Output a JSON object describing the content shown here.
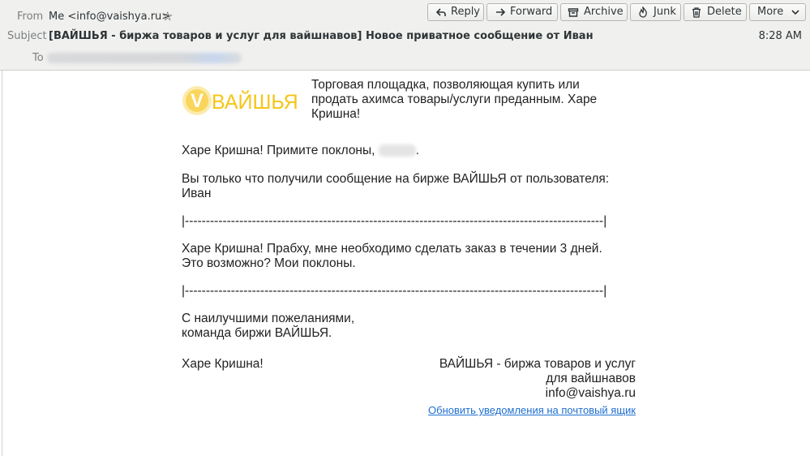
{
  "header": {
    "from_label": "From",
    "from_value": "Me <info@vaishya.ru>",
    "subject_label": "Subject",
    "subject_value": "[ВАЙШЬЯ - биржа товаров и услуг для вайшнавов] Новое приватное сообщение от Иван",
    "to_label": "To",
    "time": "8:28 AM"
  },
  "toolbar": {
    "reply": "Reply",
    "forward": "Forward",
    "archive": "Archive",
    "junk": "Junk",
    "delete": "Delete",
    "more": "More"
  },
  "email": {
    "logo_text": "ВАЙШЬЯ",
    "logo_letter": "V",
    "tagline": "Торговая площадка, позволяющая купить или\nпродать ахимса товары/услуги преданным. Харе\nКришна!",
    "greeting": "Харе Кришна! Примите поклоны, ",
    "greeting_end": ".",
    "intro": "Вы только что получили сообщение на бирже ВАЙШЬЯ от пользователя:\nИван",
    "divider": "|----------------------------------------------------------------------------------------------------|",
    "message": "Харе Кришна! Прабху, мне необходимо сделать заказ в течении 3 дней.\nЭто возможно? Мои поклоны.",
    "closing": "С наилучшими пожеланиями,\nкоманда биржи ВАЙШЬЯ.",
    "sign_left": "Харе Кришна!",
    "sign_right": "ВАЙШЬЯ - биржа товаров и услуг\nдля вайшнавов\ninfo@vaishya.ru",
    "update_link": "Обновить уведомления на почтовый ящик"
  },
  "colors": {
    "logo": "#f5c518",
    "link": "#1f6fd0",
    "header_bg": "#f0f0ef"
  }
}
